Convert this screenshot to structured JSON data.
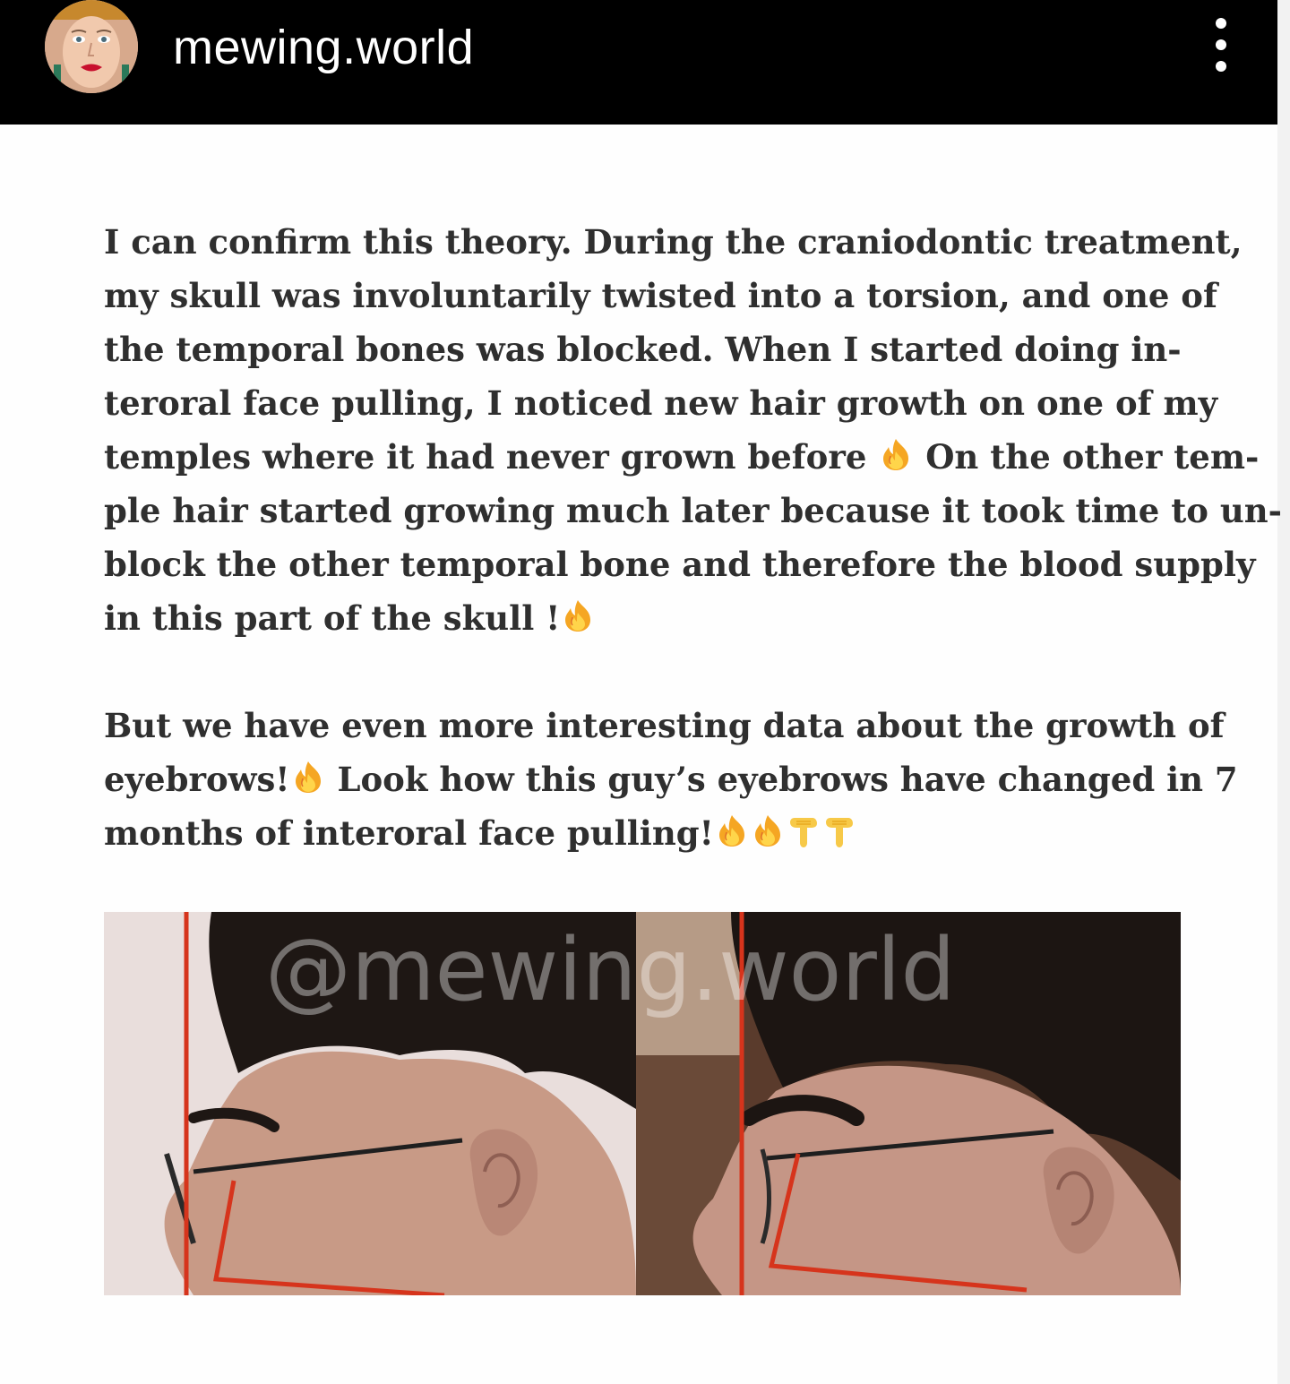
{
  "header": {
    "username": "mewing.world",
    "menu_icon": "more-vertical-icon"
  },
  "post": {
    "paragraph1_lines": [
      "I can confirm this theory. During the craniodontic treatment,",
      "my skull was involuntarily twisted into a torsion, and one of",
      "the temporal bones was blocked. When I started doing in-",
      "teroral face pulling, I noticed new hair growth on one of my",
      "temples where it had never grown before",
      "On the other tem-",
      "ple hair started growing much later because it took time to un-",
      "block the other temporal bone and therefore the blood supply",
      "in this part of the skull !"
    ],
    "paragraph2_lines": [
      "But we have even more interesting data about the growth of",
      "eyebrows!",
      "Look how this guy’s eyebrows have changed in 7",
      "months of interoral face pulling!"
    ],
    "emoji_icons": [
      "fire-emoji",
      "backhand-index-pointing-down-emoji"
    ],
    "image": {
      "watermark": "@mewing.world",
      "accent_line_color": "#d6341c"
    }
  }
}
